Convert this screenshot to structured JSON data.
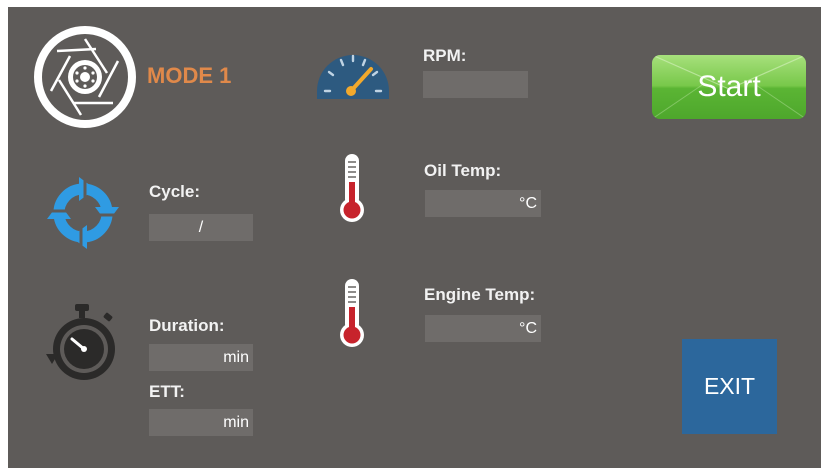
{
  "mode": {
    "label": "MODE 1"
  },
  "rpm": {
    "label": "RPM:",
    "value": ""
  },
  "start_button": {
    "label": "Start"
  },
  "cycle": {
    "label": "Cycle:",
    "value": "/"
  },
  "oil_temp": {
    "label": "Oil Temp:",
    "unit": "°C"
  },
  "engine_temp": {
    "label": "Engine Temp:",
    "unit": "°C"
  },
  "duration": {
    "label": "Duration:",
    "unit": "min"
  },
  "ett": {
    "label": "ETT:",
    "unit": "min"
  },
  "exit_button": {
    "label": "EXIT"
  },
  "colors": {
    "background": "#5e5b59",
    "field": "#6f6c6a",
    "mode_accent": "#e0894a",
    "start_green": "#5bb534",
    "exit_blue": "#2c679c",
    "cycle_icon_blue": "#2f9be3",
    "thermometer_red": "#c7232c",
    "gauge_blue": "#2d5a80",
    "gauge_needle": "#f2a92c"
  },
  "icons": {
    "mode": "aperture-disc-icon",
    "rpm": "speedometer-icon",
    "cycle": "refresh-cycle-icon",
    "oil_temp": "thermometer-icon",
    "engine_temp": "thermometer-icon",
    "duration": "stopwatch-icon"
  }
}
